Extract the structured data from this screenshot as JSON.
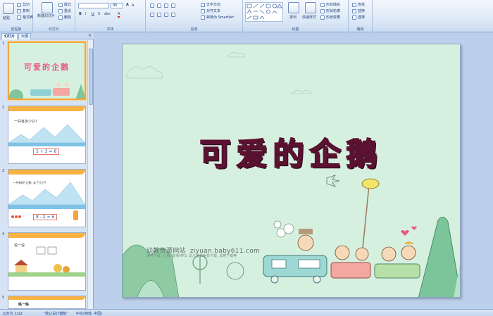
{
  "ribbon": {
    "clipboard": {
      "label": "剪贴板",
      "paste": "粘贴",
      "cut": "剪切",
      "copy": "复制",
      "format_painter": "格式刷"
    },
    "slides": {
      "label": "幻灯片",
      "new_slide": "新建幻灯片",
      "layout": "版式",
      "reset": "重设",
      "delete": "删除"
    },
    "font": {
      "label": "字体",
      "font_size": "96"
    },
    "paragraph": {
      "label": "段落",
      "text_direction": "文字方向",
      "align_text": "对齐文本",
      "smartart": "转换为 SmartArt"
    },
    "drawing": {
      "label": "绘图",
      "arrange": "排列",
      "quick_styles": "快速样式",
      "shape_fill": "形状填充",
      "shape_outline": "形状轮廓",
      "shape_effects": "形状效果"
    },
    "editing": {
      "label": "编辑",
      "find": "查找",
      "replace": "替换",
      "select": "选择"
    }
  },
  "panel": {
    "tabs": [
      "幻灯片",
      "大纲"
    ],
    "close": "×",
    "thumbnails": [
      {
        "num": "1",
        "caption": "可爱的企鹅"
      },
      {
        "num": "2",
        "caption": "一共有多少只?",
        "equation": "5 + 3 = 8"
      },
      {
        "num": "3",
        "caption": "一共有8只企鹅, 走了几只?",
        "equation": "8 - 2 = 6"
      },
      {
        "num": "4",
        "caption": "说一说"
      },
      {
        "num": "5",
        "caption": "练一练"
      }
    ]
  },
  "slide": {
    "title": "可爱的企鹅",
    "site_name": "幼教资源网站",
    "site_url": "ziyuan.baby611.com",
    "site_sub": "课件下载, 儿歌, 故事MP3, 幼儿歌曲免费下载, 试卷下载等"
  },
  "status": {
    "slide_count": "幻灯片 1/12",
    "theme": "\"默认设计模板\"",
    "language": "中文(简体, 中国)"
  },
  "colors": {
    "accent": "#f3a63a",
    "slide_bg": "#d6f0e0",
    "title": "#e9557e"
  }
}
